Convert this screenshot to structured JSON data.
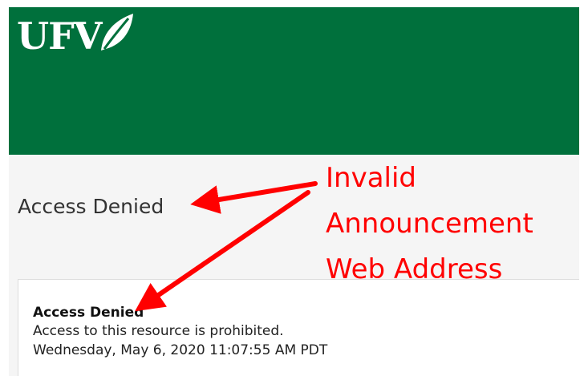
{
  "header": {
    "logo_text": "UFV"
  },
  "main": {
    "page_title": "Access Denied",
    "message": {
      "heading": "Access Denied",
      "body": "Access to this resource is prohibited.",
      "timestamp": "Wednesday, May 6, 2020 11:07:55 AM PDT"
    }
  },
  "annotation": {
    "lines": [
      "Invalid",
      "Announcement",
      "Web Address"
    ],
    "color": "#ff0000"
  },
  "colors": {
    "banner": "#00703c",
    "content_bg": "#f5f5f5"
  }
}
